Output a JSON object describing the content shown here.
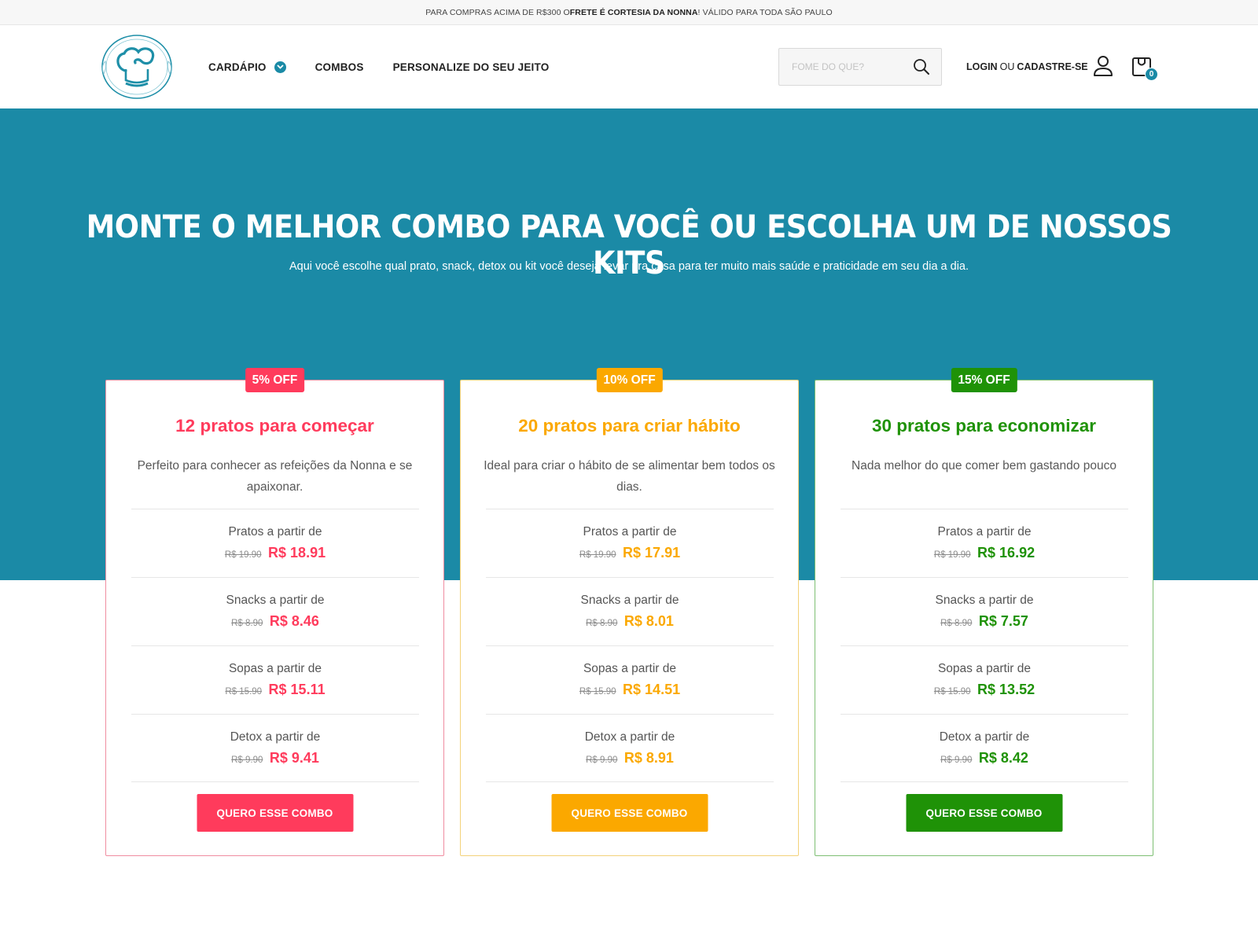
{
  "topbar": {
    "prefix": "PARA COMPRAS ACIMA DE R$300 O ",
    "highlight": "FRETE É CORTESIA DA NONNA",
    "suffix": "! VÁLIDO PARA TODA SÃO PAULO"
  },
  "header": {
    "logo_name": "chef-hat-logo",
    "nav": [
      {
        "label": "CARDÁPIO",
        "has_dropdown": true
      },
      {
        "label": "COMBOS"
      },
      {
        "label": "PERSONALIZE DO SEU JEITO"
      }
    ],
    "search": {
      "placeholder": "FOME DO QUE?",
      "value": ""
    },
    "login": {
      "login": "LOGIN",
      "ou": "OU",
      "signup": "CADASTRE-SE"
    },
    "cart_count": "0"
  },
  "hero": {
    "title": "MONTE O MELHOR COMBO PARA VOCÊ OU ESCOLHA UM DE NOSSOS KITS",
    "subtitle": "Aqui você escolhe qual prato, snack, detox ou kit você deseja levar pra casa para ter muito mais saúde e praticidade em seu dia a dia."
  },
  "colors": {
    "brand": "#1b8aa6",
    "red": "#ff3b5c",
    "orange": "#fba800",
    "green": "#1f9207"
  },
  "cards": [
    {
      "badge": "5% OFF",
      "title": "12 pratos para começar",
      "description": "Perfeito para conhecer as refeições da Nonna e se apaixonar.",
      "color": "#ff3b5c",
      "border": "#f08da0",
      "rows": [
        {
          "label": "Pratos a partir de",
          "old": "R$ 19.90",
          "new": "R$ 18.91"
        },
        {
          "label": "Snacks a partir de",
          "old": "R$ 8.90",
          "new": "R$ 8.46"
        },
        {
          "label": "Sopas a partir de",
          "old": "R$ 15.90",
          "new": "R$ 15.11"
        },
        {
          "label": "Detox a partir de",
          "old": "R$ 9.90",
          "new": "R$ 9.41"
        }
      ],
      "cta": "QUERO ESSE COMBO"
    },
    {
      "badge": "10% OFF",
      "title": "20 pratos para criar hábito",
      "description": "Ideal para criar o hábito de se alimentar bem todos os dias.",
      "color": "#fba800",
      "border": "#f3d27a",
      "rows": [
        {
          "label": "Pratos a partir de",
          "old": "R$ 19.90",
          "new": "R$ 17.91"
        },
        {
          "label": "Snacks a partir de",
          "old": "R$ 8.90",
          "new": "R$ 8.01"
        },
        {
          "label": "Sopas a partir de",
          "old": "R$ 15.90",
          "new": "R$ 14.51"
        },
        {
          "label": "Detox a partir de",
          "old": "R$ 9.90",
          "new": "R$ 8.91"
        }
      ],
      "cta": "QUERO ESSE COMBO"
    },
    {
      "badge": "15% OFF",
      "title": "30 pratos para economizar",
      "description": "Nada melhor do que comer bem gastando pouco",
      "color": "#1f9207",
      "border": "#7dbf73",
      "rows": [
        {
          "label": "Pratos a partir de",
          "old": "R$ 19.90",
          "new": "R$ 16.92"
        },
        {
          "label": "Snacks a partir de",
          "old": "R$ 8.90",
          "new": "R$ 7.57"
        },
        {
          "label": "Sopas a partir de",
          "old": "R$ 15.90",
          "new": "R$ 13.52"
        },
        {
          "label": "Detox a partir de",
          "old": "R$ 9.90",
          "new": "R$ 8.42"
        }
      ],
      "cta": "QUERO ESSE COMBO"
    }
  ]
}
